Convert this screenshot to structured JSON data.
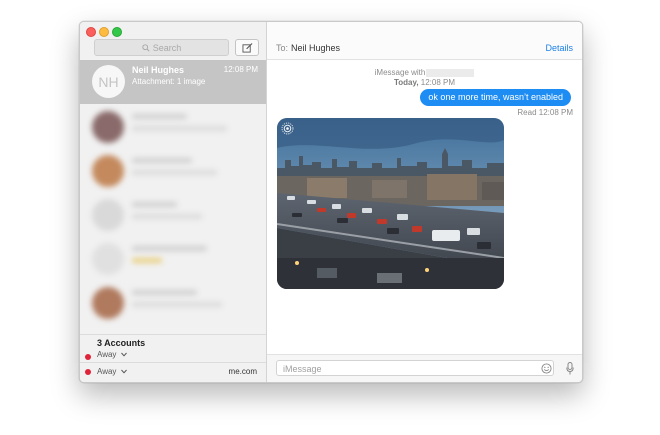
{
  "sidebar": {
    "search_placeholder": "Search",
    "selected_conversation": {
      "avatar_initials": "NH",
      "name": "Neil Hughes",
      "time": "12:08 PM",
      "preview": "Attachment: 1 image"
    },
    "accounts": {
      "title": "3 Accounts",
      "status": "Away",
      "status_secondary": "Away",
      "domain": "me.com"
    }
  },
  "conversation": {
    "to_label": "To:",
    "to_name": "Neil Hughes",
    "details_label": "Details",
    "service_line": "iMessage with",
    "date_day": "Today,",
    "date_time": "12:08 PM",
    "outgoing_message": "ok one more time, wasn’t enabled",
    "read_receipt": "Read 12:08 PM",
    "input_placeholder": "iMessage"
  },
  "colors": {
    "bubble_blue": "#1d8cf3",
    "details_link": "#1d80e8",
    "status_dot": "#e0233a",
    "selected_row": "#c5c5c5"
  },
  "icons": {
    "search": "magnifier",
    "compose": "compose-pencil",
    "live_photo": "concentric-circles",
    "emoji": "smiley",
    "microphone": "mic"
  }
}
